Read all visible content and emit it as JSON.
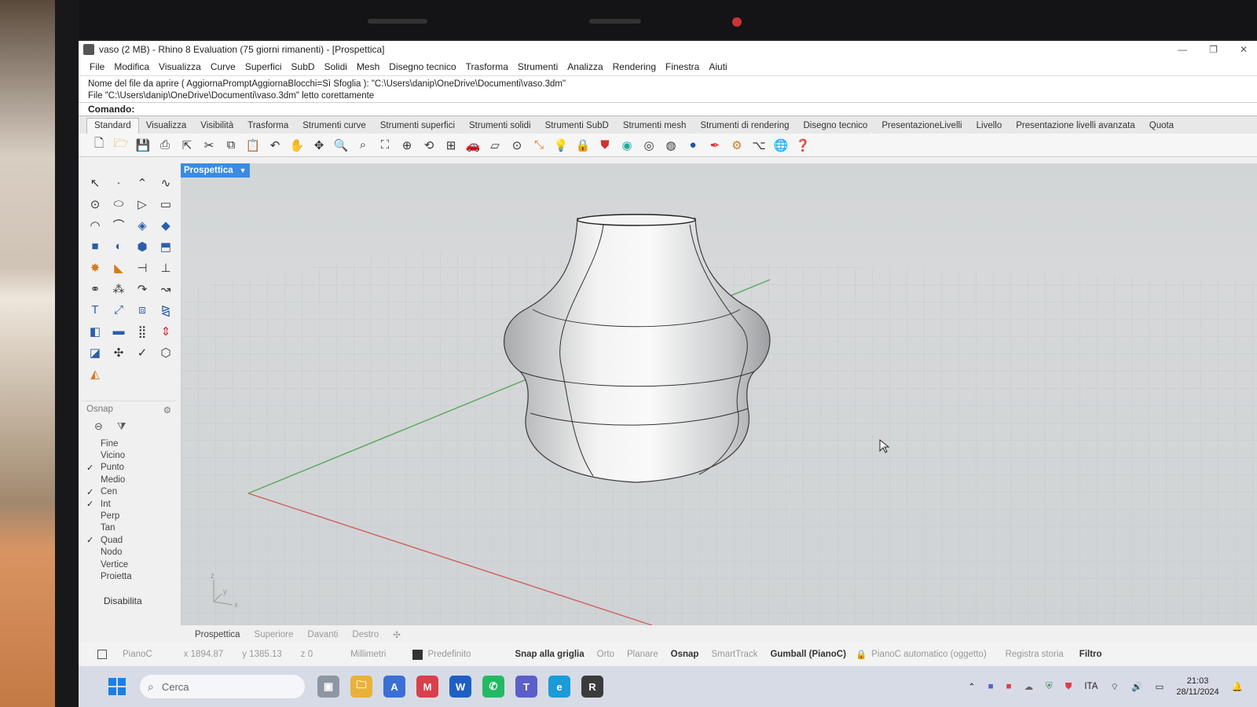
{
  "window": {
    "title": "vaso (2 MB) - Rhino 8 Evaluation (75 giorni rimanenti) - [Prospettica]",
    "minimize": "—",
    "maximize": "❐",
    "close": "✕"
  },
  "menu": [
    "File",
    "Modifica",
    "Visualizza",
    "Curve",
    "Superfici",
    "SubD",
    "Solidi",
    "Mesh",
    "Disegno tecnico",
    "Trasforma",
    "Strumenti",
    "Analizza",
    "Rendering",
    "Finestra",
    "Aiuti"
  ],
  "command_history": [
    "Nome del file da aprire ( AggiornaPromptAggiornaBlocchi=Sì  Sfoglia ): \"C:\\Users\\danip\\OneDrive\\Documenti\\vaso.3dm\"",
    "File \"C:\\Users\\danip\\OneDrive\\Documenti\\vaso.3dm\" letto corettamente"
  ],
  "command_prompt": "Comando:",
  "toolbar_tabs": [
    "Standard",
    "Visualizza",
    "Visibilità",
    "Trasforma",
    "Strumenti curve",
    "Strumenti superfici",
    "Strumenti solidi",
    "Strumenti SubD",
    "Strumenti mesh",
    "Strumenti di rendering",
    "Disegno tecnico",
    "PresentazioneLivelli",
    "Livello",
    "Presentazione livelli avanzata",
    "Quota"
  ],
  "active_toolbar_tab": "Standard",
  "viewport": {
    "label": "Prospettica",
    "axis_z": "z",
    "axis_y": "y",
    "axis_x": "x"
  },
  "osnap": {
    "title": "Osnap",
    "items": [
      {
        "label": "Fine",
        "checked": false
      },
      {
        "label": "Vicino",
        "checked": false
      },
      {
        "label": "Punto",
        "checked": true
      },
      {
        "label": "Medio",
        "checked": false
      },
      {
        "label": "Cen",
        "checked": true
      },
      {
        "label": "Int",
        "checked": true
      },
      {
        "label": "Perp",
        "checked": false
      },
      {
        "label": "Tan",
        "checked": false
      },
      {
        "label": "Quad",
        "checked": true
      },
      {
        "label": "Nodo",
        "checked": false
      },
      {
        "label": "Vertice",
        "checked": false
      },
      {
        "label": "Proietta",
        "checked": false
      }
    ],
    "disable_label": "Disabilita"
  },
  "viewport_tabs": [
    "Prospettica",
    "Superiore",
    "Davanti",
    "Destro"
  ],
  "status": {
    "plane": "PianoC",
    "x": "x 1894.87",
    "y": "y 1385.13",
    "z": "z 0",
    "units": "Millimetri",
    "layer": "Predefinito",
    "snap_grid": "Snap alla griglia",
    "orto": "Orto",
    "planare": "Planare",
    "osnap": "Osnap",
    "smarttrack": "SmartTrack",
    "gumball": "Gumball (PianoC)",
    "auto_plane": "PianoC automatico (oggetto)",
    "history": "Registra storia",
    "filter": "Filtro"
  },
  "taskbar": {
    "search_placeholder": "Cerca",
    "language": "ITA",
    "time": "21:03",
    "date": "28/11/2024"
  },
  "colors": {
    "accent": "#3b8be0",
    "axis_x": "#d06060",
    "axis_y": "#5aa85a"
  }
}
